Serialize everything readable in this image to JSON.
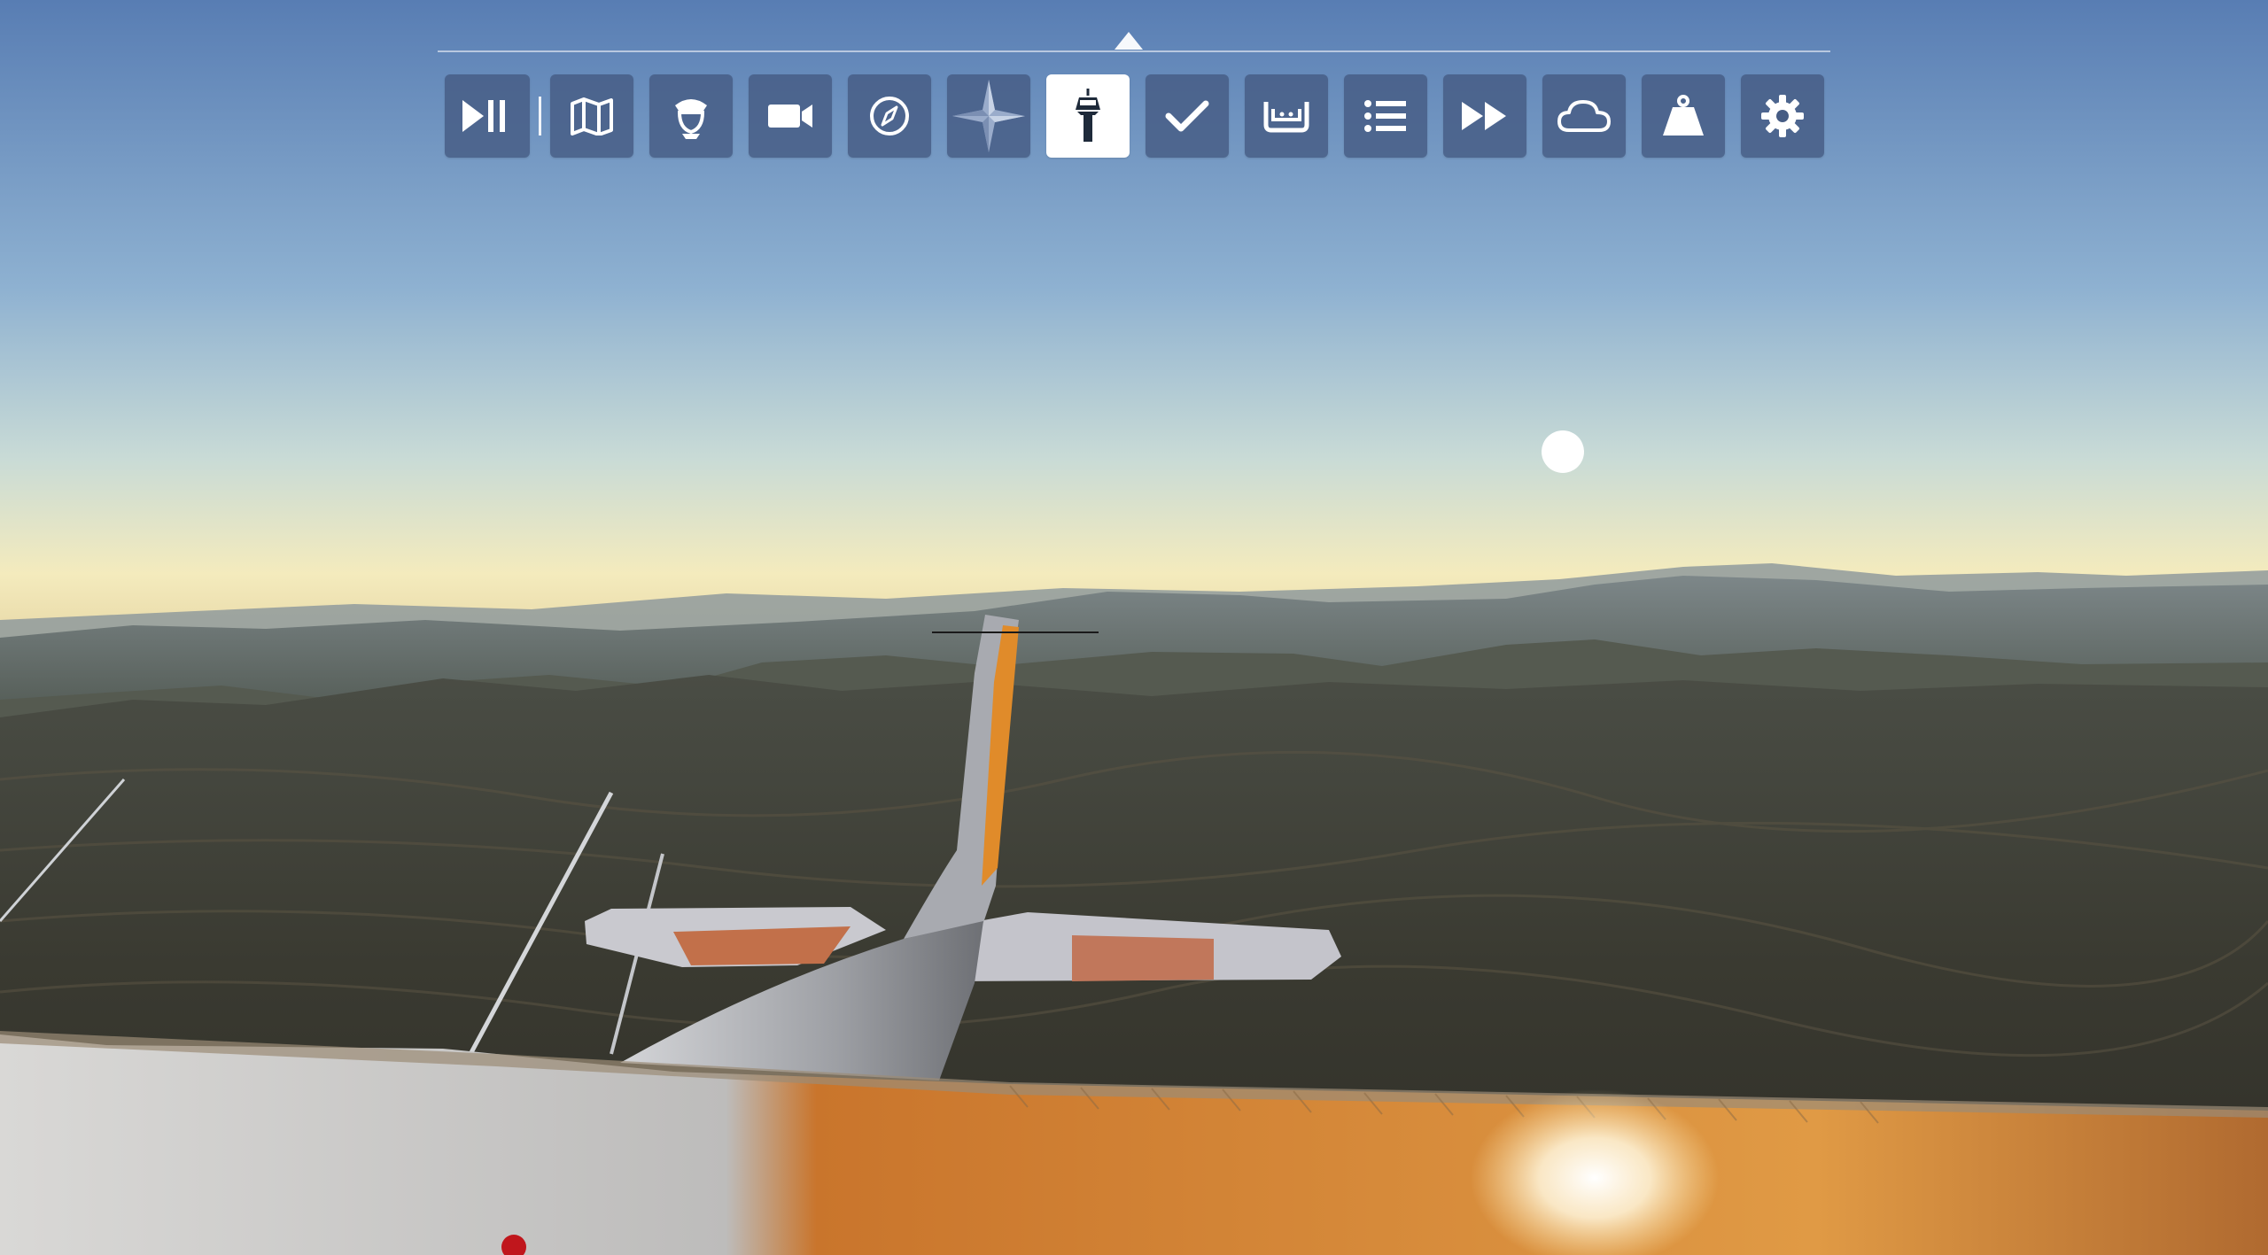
{
  "toolbar": {
    "buttons": [
      {
        "id": "pause",
        "icon": "play-pause-icon"
      },
      {
        "id": "map",
        "icon": "map-icon"
      },
      {
        "id": "pilot",
        "icon": "pilot-icon"
      },
      {
        "id": "camera",
        "icon": "camera-icon"
      },
      {
        "id": "navlog",
        "icon": "compass-icon"
      },
      {
        "id": "vfr-map",
        "icon": "compass-rose-icon"
      },
      {
        "id": "atc",
        "icon": "control-tower-icon",
        "active": true
      },
      {
        "id": "checklist",
        "icon": "checkmark-icon"
      },
      {
        "id": "controls",
        "icon": "yoke-icon"
      },
      {
        "id": "objectives",
        "icon": "list-icon"
      },
      {
        "id": "sim-rate",
        "icon": "fast-forward-icon"
      },
      {
        "id": "weather",
        "icon": "cloud-icon"
      },
      {
        "id": "weight",
        "icon": "weight-icon"
      },
      {
        "id": "settings",
        "icon": "gear-icon"
      }
    ]
  },
  "colors": {
    "button_bg": "#465c84",
    "button_active_bg": "#ffffff",
    "icon": "#ffffff",
    "icon_active": "#1e2a3a",
    "sky_top": "#5b7fb4",
    "horizon": "#f4e9bd",
    "terrain": "#3a3a32",
    "wing_orange": "#d6862c"
  }
}
